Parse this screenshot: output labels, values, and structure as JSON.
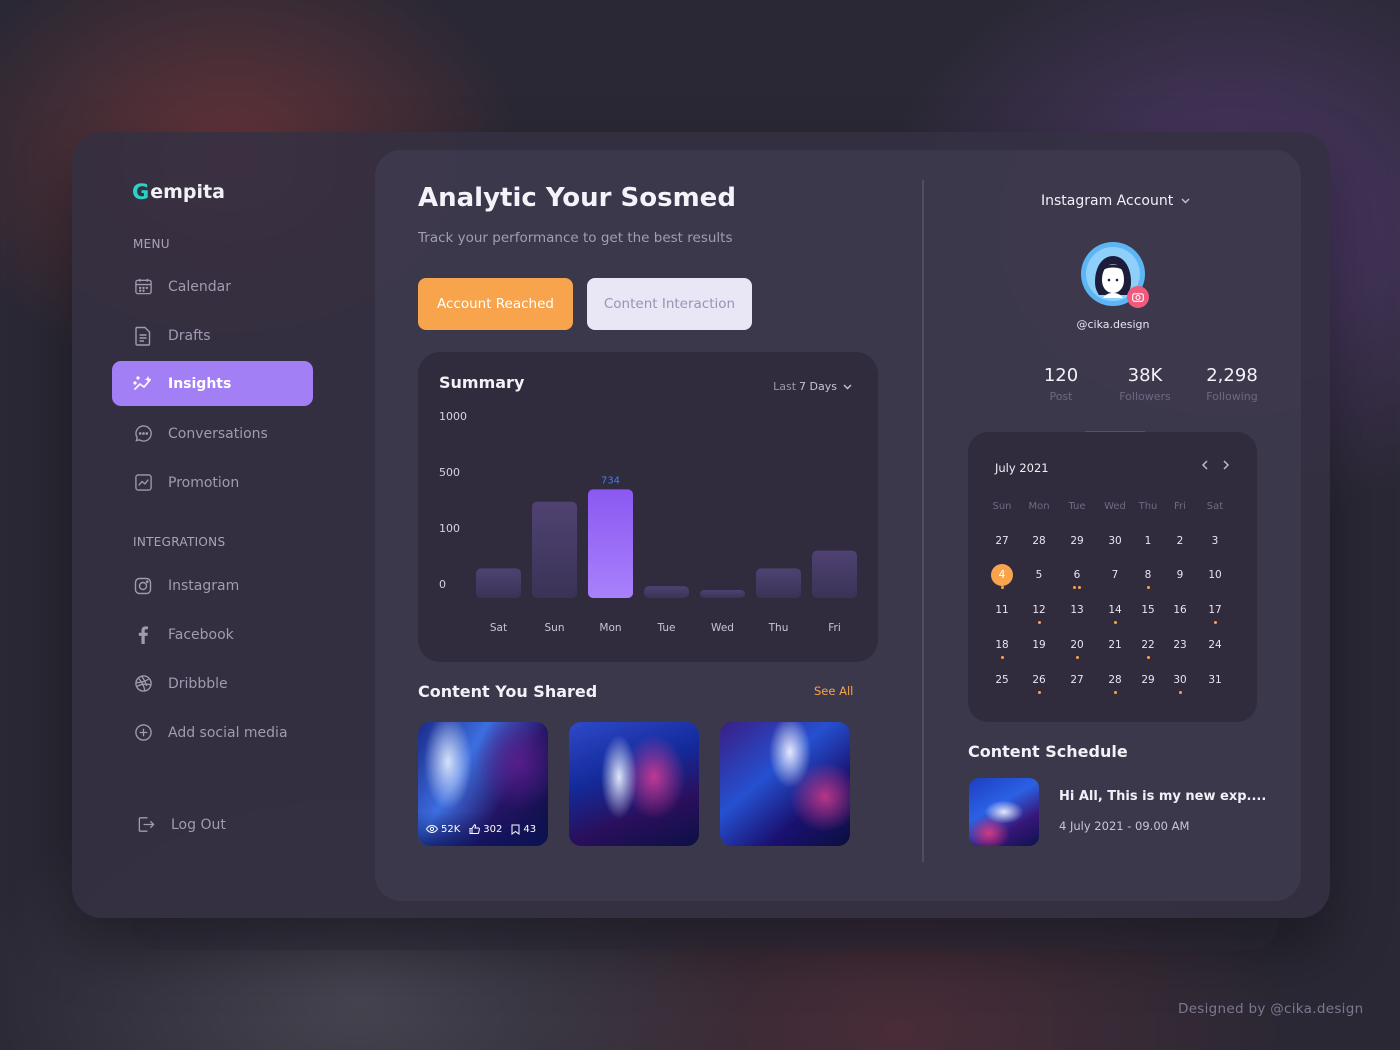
{
  "app": {
    "logo_mark": "G",
    "logo_text": "empita"
  },
  "sidebar": {
    "menu_label": "MENU",
    "menu": [
      {
        "label": "Calendar",
        "icon": "calendar-icon"
      },
      {
        "label": "Drafts",
        "icon": "document-icon"
      },
      {
        "label": "Insights",
        "icon": "sparkle-chart-icon",
        "active": true
      },
      {
        "label": "Conversations",
        "icon": "chat-bubble-icon"
      },
      {
        "label": "Promotion",
        "icon": "trend-chart-icon"
      }
    ],
    "integrations_label": "INTEGRATIONS",
    "integrations": [
      {
        "label": "Instagram",
        "icon": "instagram-icon"
      },
      {
        "label": "Facebook",
        "icon": "facebook-icon"
      },
      {
        "label": "Dribbble",
        "icon": "dribbble-icon"
      },
      {
        "label": "Add social media",
        "icon": "plus-circle-icon"
      }
    ],
    "logout": "Log Out"
  },
  "main": {
    "title": "Analytic Your Sosmed",
    "subtitle": "Track your performance to get the best results",
    "tabs": [
      {
        "label": "Account Reached",
        "active": true
      },
      {
        "label": "Content Interaction",
        "active": false
      }
    ],
    "summary": {
      "title": "Summary",
      "range_prefix": "Last",
      "range_value": "7 Days"
    },
    "content_shared": {
      "title": "Content You Shared",
      "see_all": "See All",
      "first_item_stats": {
        "views": "52K",
        "likes": "302",
        "saves": "43"
      }
    }
  },
  "chart_data": {
    "type": "bar",
    "categories": [
      "Sat",
      "Sun",
      "Mon",
      "Tue",
      "Wed",
      "Thu",
      "Fri"
    ],
    "y_tick_labels": [
      "1000",
      "500",
      "100",
      "0"
    ],
    "values": [
      200,
      650,
      734,
      80,
      25,
      200,
      320
    ],
    "highlighted_category": "Mon",
    "highlighted_label": "734",
    "ylim": [
      0,
      1000
    ],
    "grid": false
  },
  "right_panel": {
    "account_select": "Instagram Account",
    "handle": "@cika.design",
    "stats": [
      {
        "value": "120",
        "label": "Post"
      },
      {
        "value": "38K",
        "label": "Followers"
      },
      {
        "value": "2,298",
        "label": "Following"
      }
    ],
    "calendar": {
      "month": "July 2021",
      "weekdays": [
        "Sun",
        "Mon",
        "Tue",
        "Wed",
        "Thu",
        "Fri",
        "Sat"
      ],
      "weeks": [
        [
          "27",
          "28",
          "29",
          "30",
          "1",
          "2",
          "3"
        ],
        [
          "4",
          "5",
          "6",
          "7",
          "8",
          "9",
          "10"
        ],
        [
          "11",
          "12",
          "13",
          "14",
          "15",
          "16",
          "17"
        ],
        [
          "18",
          "19",
          "20",
          "21",
          "22",
          "23",
          "24"
        ],
        [
          "25",
          "26",
          "27",
          "28",
          "29",
          "30",
          "31"
        ]
      ],
      "today": "4"
    },
    "schedule_title": "Content Schedule",
    "schedule_item": {
      "text": "Hi All, This is my new exp....",
      "date": "4 July 2021 - 09.00 AM"
    }
  },
  "credit": "Designed by @cika.design",
  "colors": {
    "accent_purple": "#a37ff5",
    "accent_orange": "#f8a44c",
    "logo_teal": "#29d3c6",
    "highlight_blue": "#3f7df0"
  }
}
